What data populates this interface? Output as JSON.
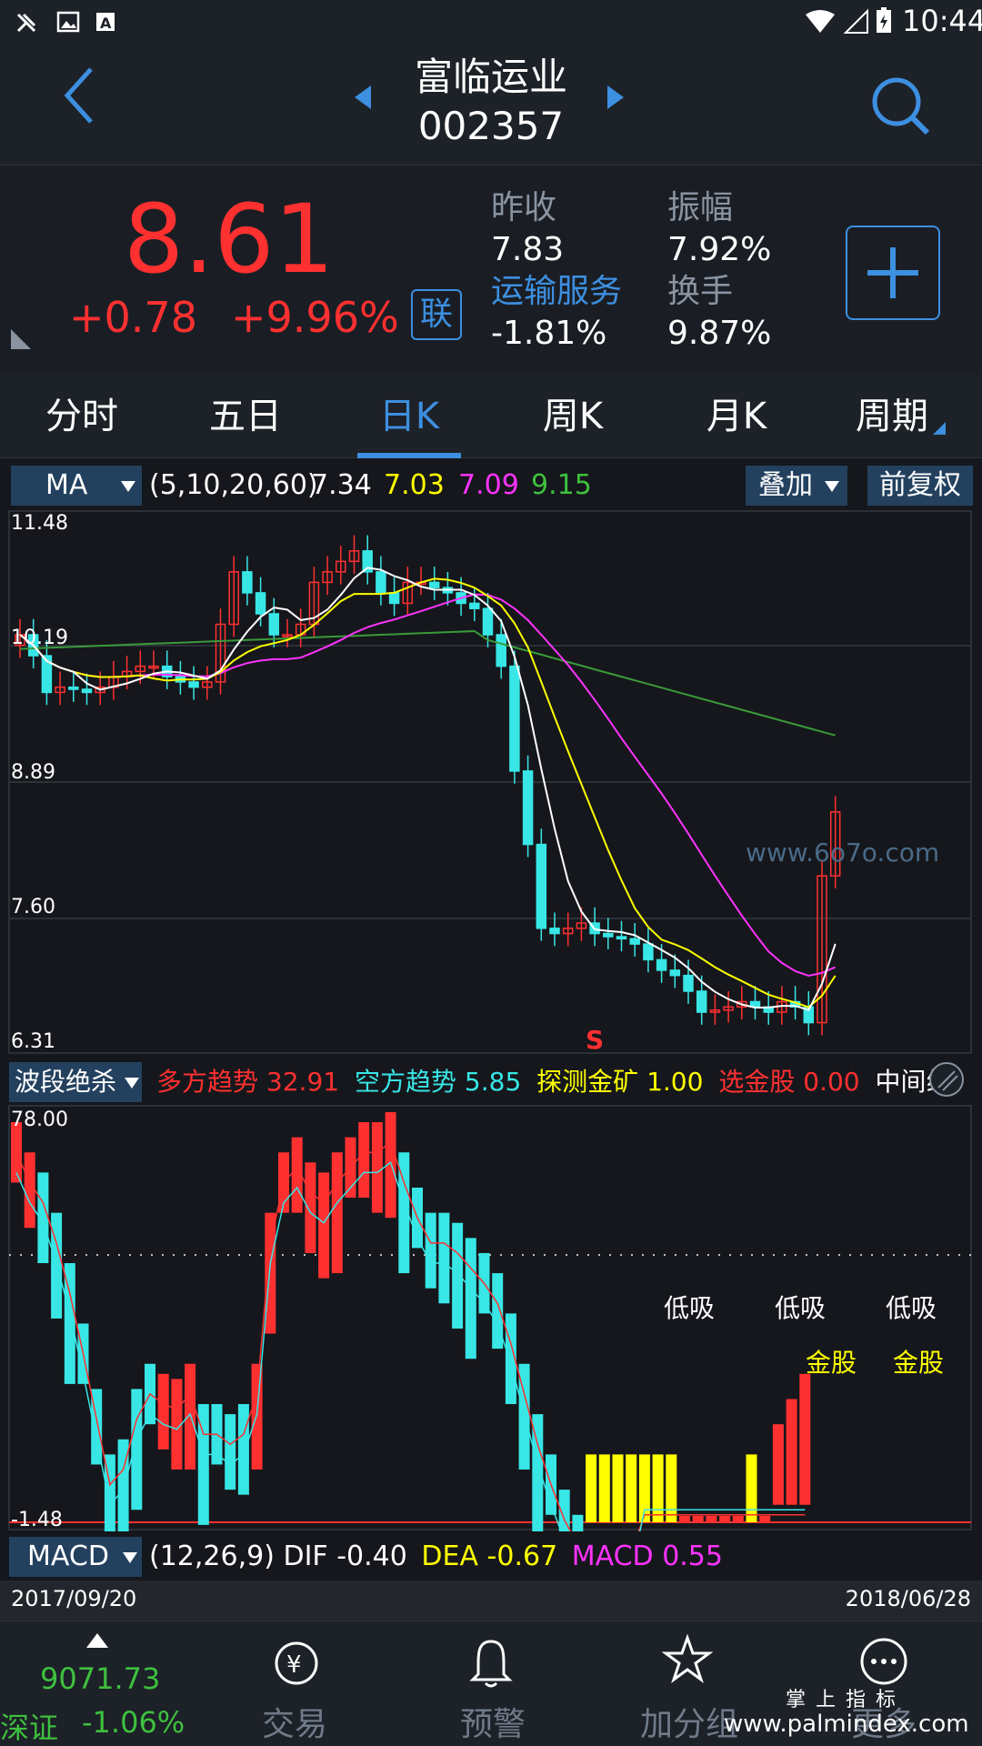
{
  "status_bar": {
    "time": "10:44"
  },
  "header": {
    "stock_name": "富临运业",
    "stock_code": "002357"
  },
  "quote": {
    "price": "8.61",
    "change": "+0.78",
    "change_pct": "+9.96%",
    "link_badge": "联",
    "prev_close_label": "昨收",
    "prev_close": "7.83",
    "amplitude_label": "振幅",
    "amplitude": "7.92%",
    "sector_label": "运输服务",
    "sector_change": "-1.81%",
    "turnover_label": "换手",
    "turnover": "9.87%"
  },
  "tabs": [
    "分时",
    "五日",
    "日K",
    "周K",
    "月K",
    "周期"
  ],
  "active_tab": "日K",
  "ma_bar": {
    "indicator": "MA",
    "params": "(5,10,20,60)",
    "values": [
      "7.34",
      "7.03",
      "7.09",
      "9.15"
    ],
    "overlay": "叠加",
    "adjust": "前复权"
  },
  "price_axis": [
    "11.48",
    "10.19",
    "8.89",
    "7.60",
    "6.31"
  ],
  "watermark": "www.6o7o.com",
  "signal_mark": "S",
  "indicator_bar": {
    "name": "波段绝杀",
    "items": [
      {
        "label": "多方趋势",
        "value": "32.91"
      },
      {
        "label": "空方趋势",
        "value": "5.85"
      },
      {
        "label": "探测金矿",
        "value": "1.00"
      },
      {
        "label": "选金股",
        "value": "0.00"
      }
    ],
    "extra": "中间线"
  },
  "indicator_axis": {
    "top": "78.00",
    "bottom": "-1.48"
  },
  "indicator_labels": {
    "low_buy": "低吸",
    "gold": "金股"
  },
  "macd_bar": {
    "name": "MACD",
    "params": "(12,26,9)",
    "dif_label": "DIF",
    "dif": "-0.40",
    "dea_label": "DEA",
    "dea": "-0.67",
    "macd_label": "MACD",
    "macd": "0.55"
  },
  "date_range": {
    "start": "2017/09/20",
    "end": "2018/06/28"
  },
  "bottom_nav": {
    "index_value": "9071.73",
    "index_name": "深证",
    "index_change": "-1.06%",
    "items": [
      "交易",
      "预警",
      "加分组",
      "更多"
    ]
  },
  "corner_watermark": {
    "line1": "掌 上 指 标",
    "line2": "www.palmindex.com"
  },
  "colors": {
    "up": "#ff3030",
    "down": "#38e6e6",
    "accent": "#3d8fe0",
    "ma5": "#ffffff",
    "ma10": "#ffff00",
    "ma20": "#ff33ff",
    "ma60": "#3a9a3a",
    "bg": "#15171c"
  }
}
